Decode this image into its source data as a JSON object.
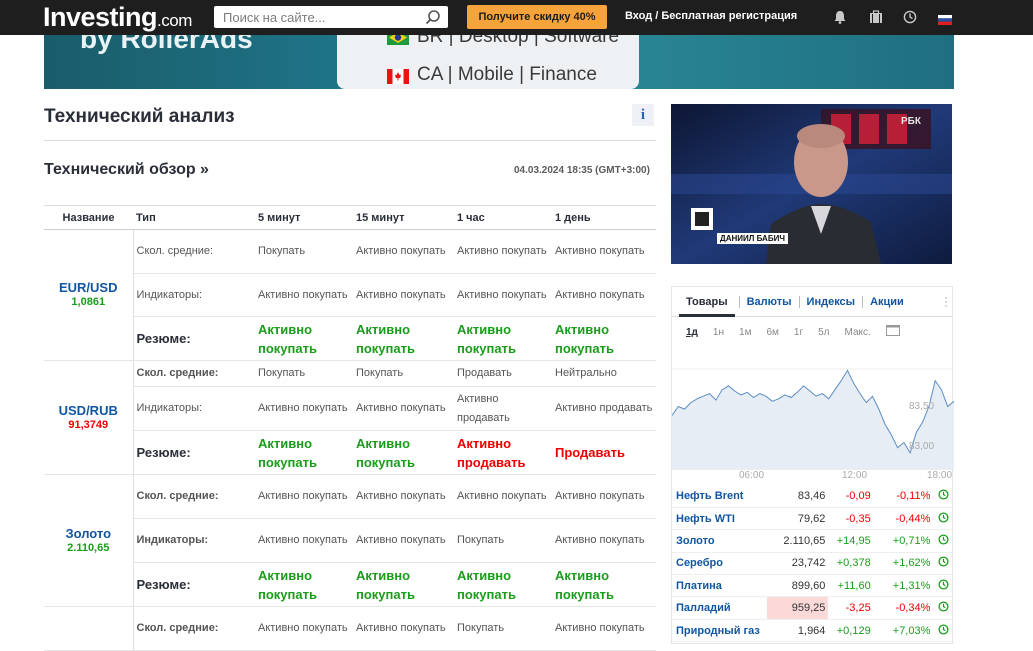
{
  "header": {
    "logo": "Investing",
    "logo_domain": ".com",
    "search_placeholder": "Поиск на сайте...",
    "promo_label": "Получите скидку 40%",
    "login_label": "Вход / Бесплатная регистрация"
  },
  "banner": {
    "brand": "by RollerAds",
    "row1": "BR | Desktop | Software",
    "row2": "CA | Mobile | Finance"
  },
  "page": {
    "title": "Технический анализ",
    "info_icon": "i",
    "overview_title": "Технический обзор »",
    "timestamp": "04.03.2024 18:35 (GMT+3:00)"
  },
  "ta_table": {
    "headers": [
      "Название",
      "Тип",
      "5 минут",
      "15 минут",
      "1 час",
      "1 день"
    ],
    "instruments": [
      {
        "name": "EUR/USD",
        "price": "1,0861",
        "price_color": "up",
        "rows": [
          {
            "type": "Скол. средние:",
            "values": [
              "Покупать",
              "Активно покупать",
              "Активно покупать",
              "Активно покупать"
            ],
            "classes": [
              "",
              "",
              "",
              ""
            ]
          },
          {
            "type": "Индикаторы:",
            "values": [
              "Активно покупать",
              "Активно покупать",
              "Активно покупать",
              "Активно покупать"
            ],
            "classes": [
              "",
              "",
              "",
              ""
            ]
          },
          {
            "type": "Резюме:",
            "values": [
              "Активно покупать",
              "Активно покупать",
              "Активно покупать",
              "Активно покупать"
            ],
            "classes": [
              "buy",
              "buy",
              "buy",
              "buy"
            ]
          }
        ]
      },
      {
        "name": "USD/RUB",
        "price": "91,3749",
        "price_color": "down",
        "rows": [
          {
            "type": "Скол. средние:",
            "values": [
              "Покупать",
              "Покупать",
              "Продавать",
              "Нейтрально"
            ],
            "classes": [
              "",
              "",
              "",
              ""
            ]
          },
          {
            "type": "Индикаторы:",
            "values": [
              "Активно покупать",
              "Активно покупать",
              "Активно продавать",
              "Активно продавать"
            ],
            "classes": [
              "",
              "",
              "",
              ""
            ]
          },
          {
            "type": "Резюме:",
            "values": [
              "Активно покупать",
              "Активно покупать",
              "Активно продавать",
              "Продавать"
            ],
            "classes": [
              "buy",
              "buy",
              "sell",
              "sell"
            ]
          }
        ]
      },
      {
        "name": "Золото",
        "price": "2.110,65",
        "price_color": "up",
        "rows": [
          {
            "type": "Скол. средние:",
            "values": [
              "Активно покупать",
              "Активно покупать",
              "Активно покупать",
              "Активно покупать"
            ],
            "classes": [
              "",
              "",
              "",
              ""
            ]
          },
          {
            "type": "Индикаторы:",
            "values": [
              "Активно покупать",
              "Активно покупать",
              "Покупать",
              "Активно покупать"
            ],
            "classes": [
              "",
              "",
              "",
              ""
            ]
          },
          {
            "type": "Резюме:",
            "values": [
              "Активно покупать",
              "Активно покупать",
              "Активно покупать",
              "Активно покупать"
            ],
            "classes": [
              "buy",
              "buy",
              "buy",
              "buy"
            ]
          }
        ]
      },
      {
        "name": "",
        "price": "",
        "price_color": "up",
        "rows": [
          {
            "type": "Скол. средние:",
            "values": [
              "Активно покупать",
              "Активно покупать",
              "Покупать",
              "Активно покупать"
            ],
            "classes": [
              "",
              "",
              "",
              ""
            ]
          }
        ]
      }
    ]
  },
  "video": {
    "channel": "РБК",
    "person_caption": "ДАНИИЛ БАБИЧ"
  },
  "market_panel": {
    "tabs": [
      "Товары",
      "Валюты",
      "Индексы",
      "Акции"
    ],
    "periods": [
      "1д",
      "1н",
      "1м",
      "6м",
      "1г",
      "5л",
      "Макс."
    ],
    "chart_data": {
      "type": "line",
      "x_ticks": [
        "06:00",
        "12:00",
        "18:00"
      ],
      "y_ticks": [
        "83,50",
        "83,00"
      ],
      "values": [
        83.35,
        83.42,
        83.4,
        83.45,
        83.48,
        83.5,
        83.52,
        83.47,
        83.55,
        83.58,
        83.54,
        83.51,
        83.53,
        83.49,
        83.52,
        83.5,
        83.46,
        83.48,
        83.51,
        83.49,
        83.53,
        83.58,
        83.54,
        83.5,
        83.52,
        83.48,
        83.55,
        83.62,
        83.7,
        83.6,
        83.52,
        83.45,
        83.5,
        83.4,
        83.28,
        83.2,
        83.1,
        83.14,
        83.06,
        83.22,
        83.3,
        83.42,
        83.62,
        83.55,
        83.42,
        83.46
      ]
    },
    "rows": [
      {
        "name": "Нефть Brent",
        "value": "83,46",
        "change": "-0,09",
        "pct": "-0,11%",
        "dir": "dn",
        "hl": false
      },
      {
        "name": "Нефть WTI",
        "value": "79,62",
        "change": "-0,35",
        "pct": "-0,44%",
        "dir": "dn",
        "hl": false
      },
      {
        "name": "Золото",
        "value": "2.110,65",
        "change": "+14,95",
        "pct": "+0,71%",
        "dir": "up",
        "hl": false
      },
      {
        "name": "Серебро",
        "value": "23,742",
        "change": "+0,378",
        "pct": "+1,62%",
        "dir": "up",
        "hl": false
      },
      {
        "name": "Платина",
        "value": "899,60",
        "change": "+11,60",
        "pct": "+1,31%",
        "dir": "up",
        "hl": false
      },
      {
        "name": "Палладий",
        "value": "959,25",
        "change": "-3,25",
        "pct": "-0,34%",
        "dir": "dn",
        "hl": true
      },
      {
        "name": "Природный газ",
        "value": "1,964",
        "change": "+0,129",
        "pct": "+7,03%",
        "dir": "up",
        "hl": false
      }
    ]
  }
}
